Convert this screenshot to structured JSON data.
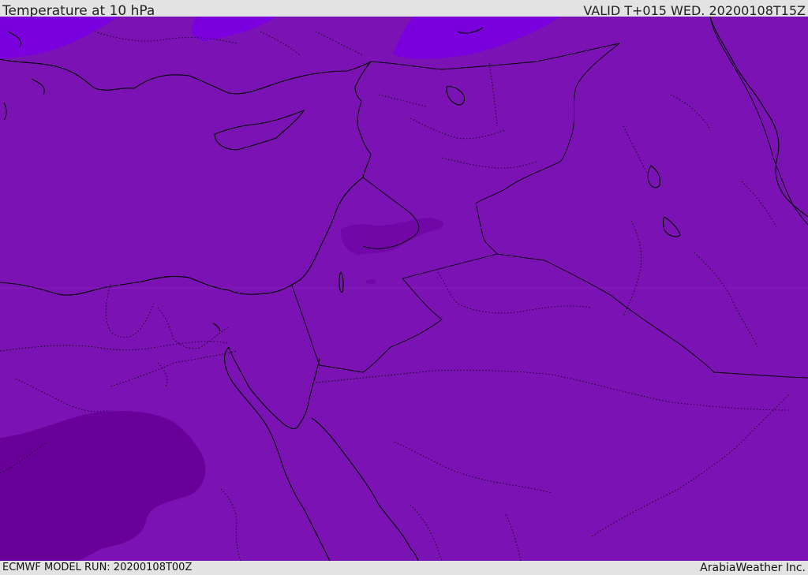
{
  "header": {
    "title": "Temperature at 10 hPa",
    "valid": "VALID T+015 WED. 20200108T15Z"
  },
  "footer": {
    "model_run": "ECMWF MODEL RUN: 20200108T00Z",
    "credit": "ArabiaWeather Inc."
  },
  "map": {
    "fill_main": "#7b12b3",
    "fill_light": "#7a00dd",
    "fill_dark": "#690099",
    "fill_medium": "#7007a6",
    "border_color": "#000000"
  }
}
